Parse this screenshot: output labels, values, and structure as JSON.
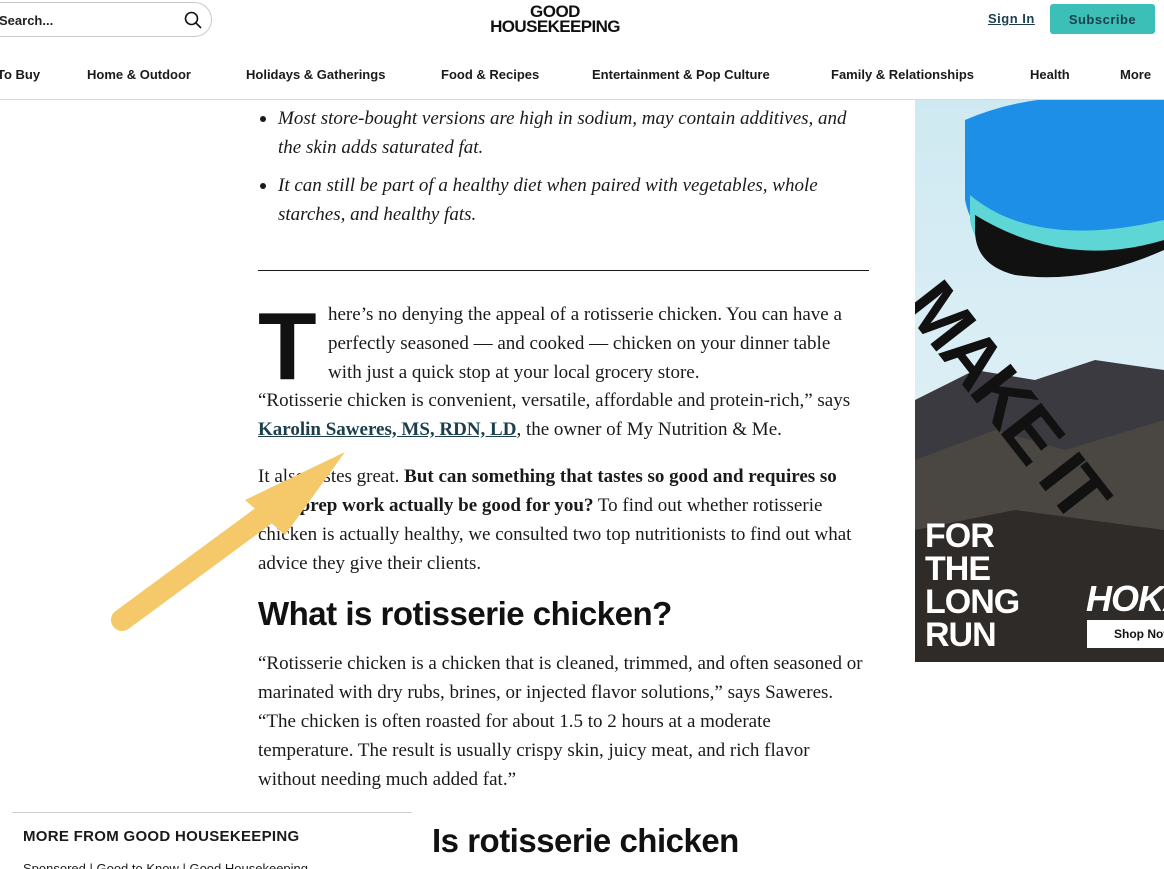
{
  "header": {
    "search_placeholder": "Search...",
    "logo_line1": "GOOD",
    "logo_line2": "HOUSEKEEPING",
    "signin_label": "Sign In",
    "subscribe_label": "Subscribe"
  },
  "nav": {
    "items": [
      "To Buy",
      "Home & Outdoor",
      "Holidays & Gatherings",
      "Food & Recipes",
      "Entertainment & Pop Culture",
      "Family & Relationships",
      "Health",
      "More"
    ]
  },
  "article": {
    "bullets": [
      "Most store-bought versions are high in sodium, may contain additives, and the skin adds saturated fat.",
      "It can still be part of a healthy diet when paired with vegetables, whole starches, and healthy fats."
    ],
    "drop_cap": "T",
    "p1_lead": "here’s no denying the appeal of a rotisserie chicken. You can have a perfectly seasoned — and cooked — chicken on your dinner table with just a quick stop at your local grocery store.",
    "p1_rest_before": "“Rotisserie chicken is convenient, versatile, affordable and protein-rich,” says ",
    "p1_link": "Karolin Saweres, MS, RDN, LD",
    "p1_rest_after": ", the owner of My Nutrition & Me.",
    "p2_before": "It also tastes great. ",
    "p2_bold": "But can something that tastes so good and requires so little prep work actually be good for you?",
    "p2_after": " To find out whether rotisserie chicken is actually healthy, we consulted two top nutritionists to find out what advice they give their clients.",
    "h2": "What is rotisserie chicken?",
    "p3": "“Rotisserie chicken is a chicken that is cleaned, trimmed, and often seasoned or marinated with dry rubs, brines, or injected flavor solutions,” says Saweres. “The chicken is often roasted for about 1.5 to 2 hours at a moderate temperature. The result is usually crispy skin, juicy meat, and rich flavor without needing much added fat.”",
    "h2b": "Is rotisserie chicken healthy?"
  },
  "more_from": {
    "title": "MORE FROM GOOD HOUSEKEEPING",
    "links": "Sponsored | Good to Know | Good Housekeeping"
  },
  "ad": {
    "headline": "MAKE IT",
    "tagline_lines": [
      "FOR",
      "THE",
      "LONG",
      "RUN"
    ],
    "brand": "HOKA",
    "cta": "Shop Now",
    "colors": {
      "shoe": "#1e8fe6",
      "sky": "#d8eef5",
      "rock": "#3a3a40"
    }
  },
  "annotation": {
    "arrow_color": "#f5c86a"
  }
}
